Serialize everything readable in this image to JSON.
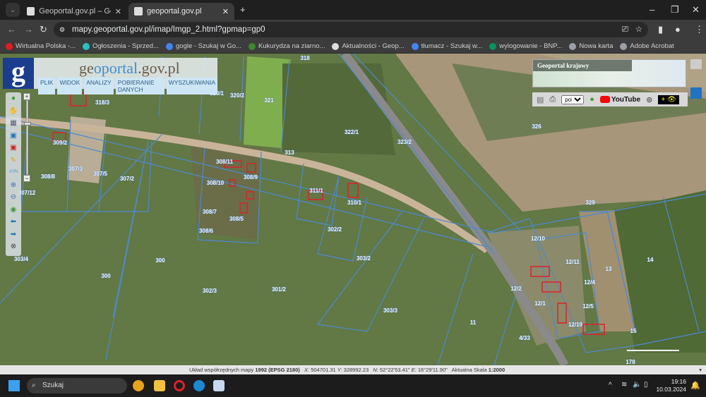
{
  "browser": {
    "tabs": [
      {
        "label": "Geoportal.gov.pl – Geoportal Ir",
        "active": false
      },
      {
        "label": "geoportal.gov.pl",
        "active": true
      }
    ],
    "new_tab": "+",
    "url": "mapy.geoportal.gov.pl/imap/Imgp_2.html?gpmap=gp0",
    "bookmarks": [
      {
        "label": "Wirtualna Polska -...",
        "color": "#e21b23"
      },
      {
        "label": "Ogłoszenia - Sprzed...",
        "color": "#23c3c3"
      },
      {
        "label": "gogle - Szukaj w Go...",
        "color": "#4285f4"
      },
      {
        "label": "Kukurydza na ziarno...",
        "color": "#3a8a2a"
      },
      {
        "label": "Aktualności - Geop...",
        "color": "#dddddd"
      },
      {
        "label": "tłumacz - Szukaj w...",
        "color": "#4285f4"
      },
      {
        "label": "wylogowanie - BNP...",
        "color": "#00965e"
      },
      {
        "label": "Nowa karta",
        "color": "#9aa0a6"
      },
      {
        "label": "Adobe Acrobat",
        "color": "#9aa0a6"
      }
    ]
  },
  "geoportal": {
    "logo_letter": "g",
    "title_prefix": "ge",
    "title_mid": "oportal",
    "title_suffix": ".gov.pl",
    "menu": [
      "PLIK",
      "WIDOK",
      "ANALIZY",
      "POBIERANIE DANYCH",
      "WYSZUKIWANIA"
    ],
    "tools": [
      "info-icon",
      "pan-hand-icon",
      "calculator-icon",
      "select-blue-icon",
      "select-red-icon",
      "pencil-icon",
      "xyz-icon",
      "zoom-in-icon",
      "zoom-out-icon",
      "globe-icon",
      "back-arrow-icon",
      "forward-arrow-icon",
      "crosshair-icon"
    ],
    "tool_glyphs": [
      "●",
      "✋",
      "▦",
      "▣",
      "▣",
      "✎",
      "XYN",
      "⊕",
      "⊖",
      "◉",
      "⬅",
      "➡",
      "⊗"
    ],
    "zoom_plus": "+",
    "zoom_minus": "−",
    "overview_title": "Geoportal krajowy",
    "language": "pol",
    "youtube": "YouTube",
    "parcels": [
      "318",
      "317",
      "318/1",
      "320/1",
      "320/2",
      "321",
      "318/3",
      "309/2",
      "322/1",
      "323/2",
      "326",
      "313",
      "308/11",
      "308/9",
      "308/10",
      "307/3",
      "307/5",
      "307/2",
      "308/8",
      "307/12",
      "311/1",
      "310/1",
      "308/7",
      "308/5",
      "308/6",
      "302/2",
      "329",
      "12/10",
      "12/11",
      "13",
      "14",
      "303/4",
      "300",
      "300",
      "303/2",
      "302/3",
      "301/2",
      "303/3",
      "11",
      "12/2",
      "12/1",
      "4/33",
      "12/19",
      "15",
      "178",
      "12/4",
      "12/5"
    ]
  },
  "status": {
    "crs_label": "Układ współrzędnych mapy",
    "crs_value": "1992 (EPSG 2180)",
    "x_label": "X:",
    "x": "504701.31",
    "y_label": "Y:",
    "y": "328992.23",
    "n_label": "N:",
    "n": "52°22'53.41\"",
    "e_label": "E:",
    "e": "16°29'11.90\"",
    "scale_label": "Aktualna Skala",
    "scale": "1:2000"
  },
  "taskbar": {
    "search": "Szukaj",
    "time": "19:16",
    "date": "10.03.2024"
  }
}
